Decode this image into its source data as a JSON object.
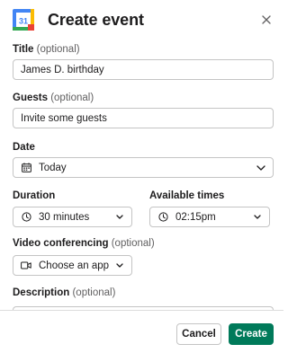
{
  "dialog": {
    "title": "Create event",
    "app_icon_text": "31"
  },
  "fields": {
    "title": {
      "label": "Title",
      "optional": "(optional)",
      "value": "James D. birthday"
    },
    "guests": {
      "label": "Guests",
      "optional": "(optional)",
      "placeholder": "Invite some guests"
    },
    "date": {
      "label": "Date",
      "value": "Today",
      "icon": "calendar-icon"
    },
    "duration": {
      "label": "Duration",
      "value": "30 minutes",
      "icon": "clock-icon"
    },
    "available_times": {
      "label": "Available times",
      "value": "02:15pm",
      "icon": "clock-icon"
    },
    "video": {
      "label": "Video conferencing",
      "optional": "(optional)",
      "value": "Choose an app",
      "icon": "video-icon"
    },
    "description": {
      "label": "Description",
      "optional": "(optional)"
    }
  },
  "footer": {
    "cancel_label": "Cancel",
    "create_label": "Create"
  },
  "colors": {
    "primary": "#007a5a",
    "border": "#c4c4c4",
    "text": "#1d1c1d",
    "muted": "#616061",
    "gcal_blue": "#4285f4",
    "gcal_green": "#34a853",
    "gcal_yellow": "#fbbc04",
    "gcal_red": "#ea4335"
  }
}
